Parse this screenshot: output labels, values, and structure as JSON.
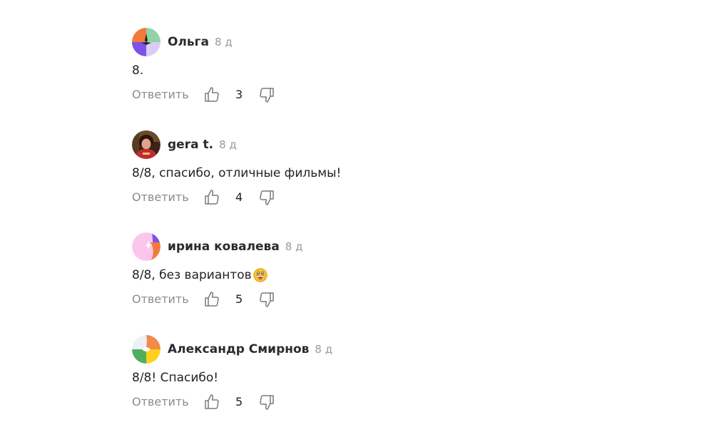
{
  "comments": [
    {
      "author": "Ольга",
      "time": "8 д",
      "text": "8.",
      "reply_label": "Ответить",
      "likes": "3",
      "avatar": "avatar-geometric-orange-purple-green"
    },
    {
      "author": "gera t.",
      "time": "8 д",
      "text": "8/8, спасибо, отличные фильмы!",
      "reply_label": "Ответить",
      "likes": "4",
      "avatar": "avatar-photo"
    },
    {
      "author": "ирина ковалева",
      "time": "8 д",
      "text": "8/8, без вариантов",
      "emoji": "grinning-face-emoji",
      "reply_label": "Ответить",
      "likes": "5",
      "avatar": "avatar-geometric-pink-orange-purple"
    },
    {
      "author": "Александр Смирнов",
      "time": "8 д",
      "text": "8/8! Спасибо!",
      "reply_label": "Ответить",
      "likes": "5",
      "avatar": "avatar-geometric-orange-green-yellow"
    }
  ],
  "colors": {
    "reply_text": "#8b8b8b",
    "time_text": "#9a9a9a",
    "icon_stroke": "#7a7a7a"
  }
}
